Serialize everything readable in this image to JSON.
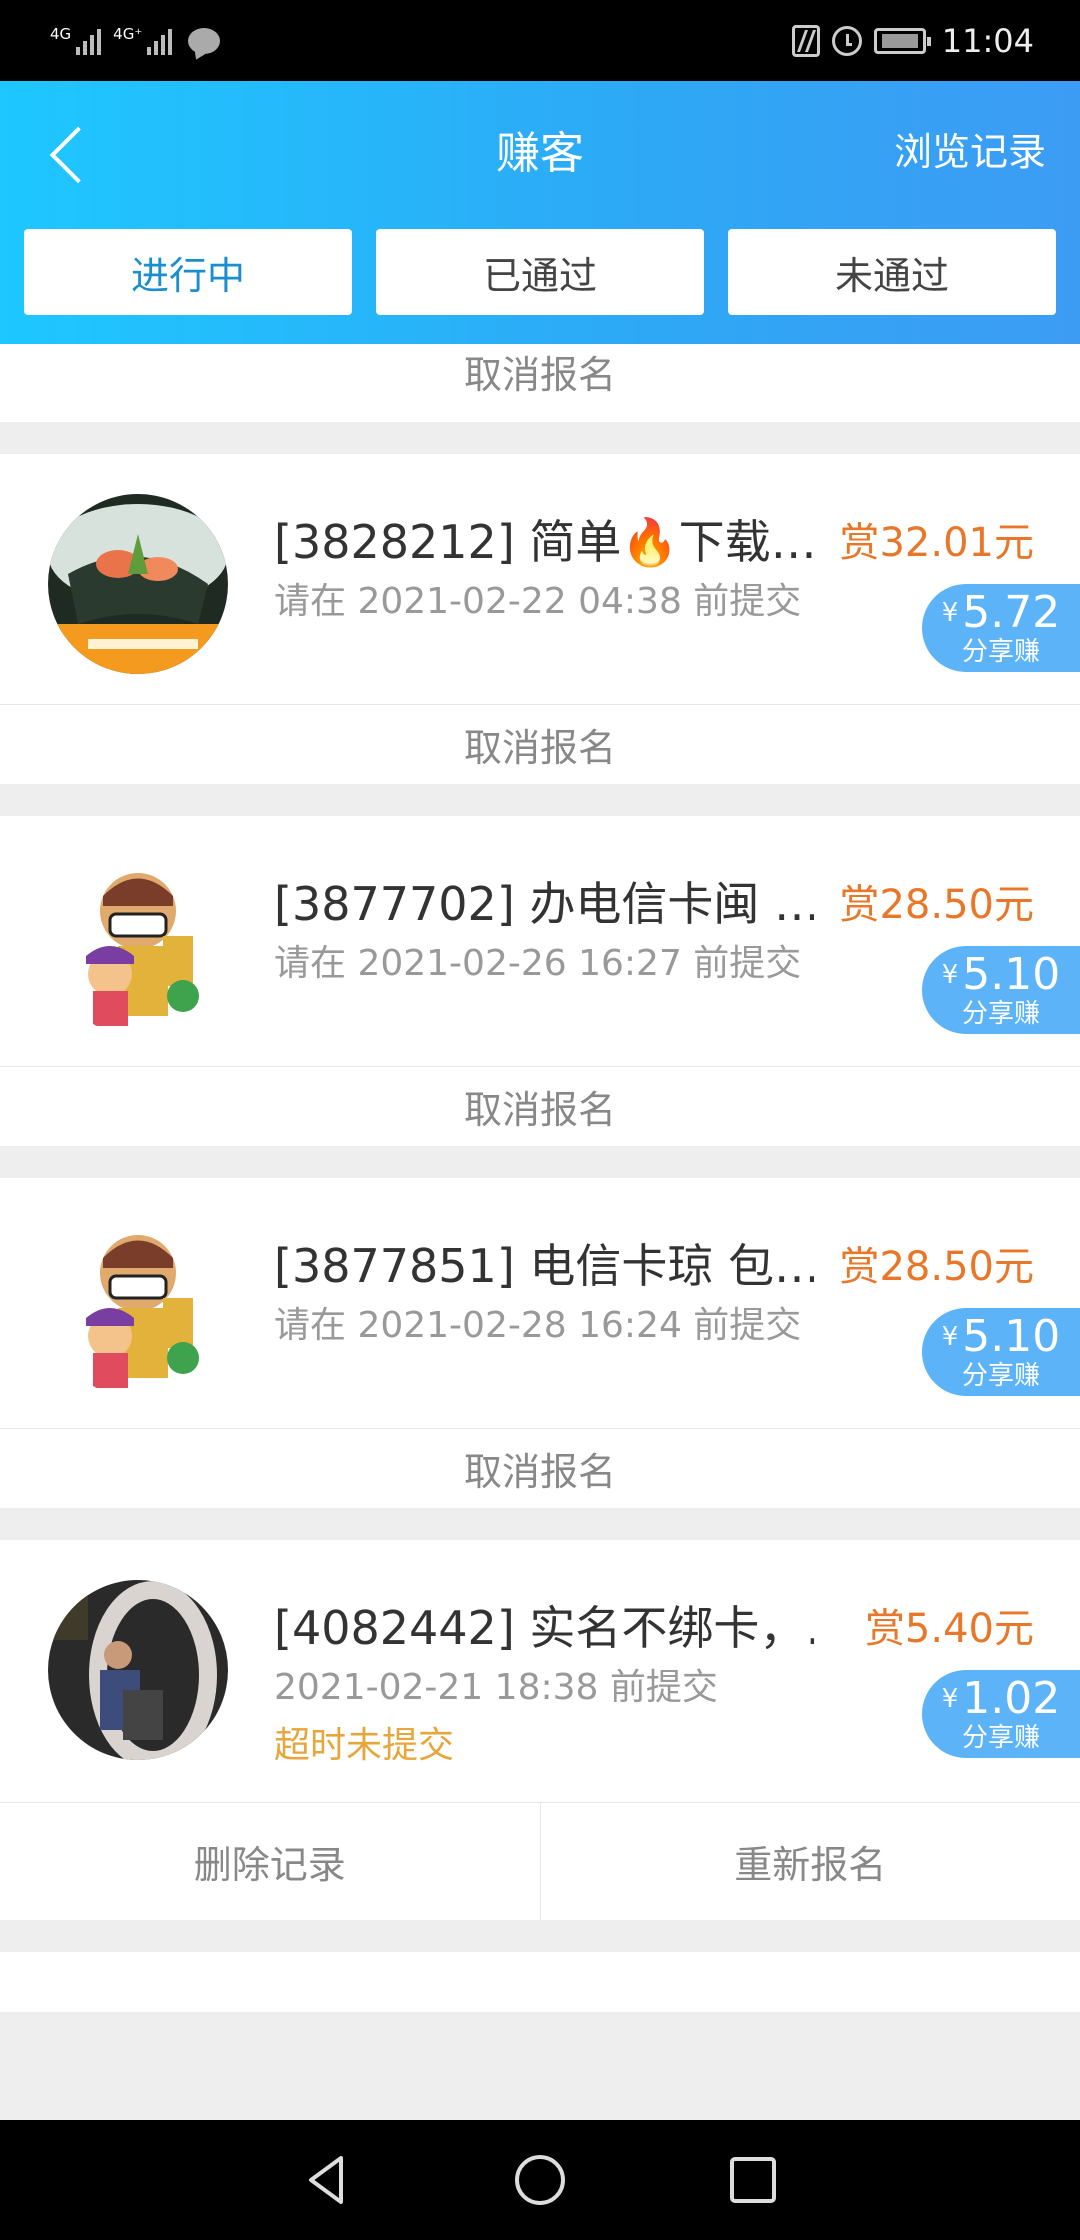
{
  "status_bar": {
    "network1": "4G",
    "network2": "4G⁺",
    "time": "11:04"
  },
  "header": {
    "title": "赚客",
    "history_label": "浏览记录",
    "tabs": [
      "进行中",
      "已通过",
      "未通过"
    ],
    "active_tab": 0
  },
  "partial_action": "取消报名",
  "tasks": [
    {
      "title": "[3828212] 简单🔥下载…",
      "deadline": "请在 2021-02-22 04:38 前提交",
      "reward": "赏32.01元",
      "share_currency": "¥",
      "share_amount": "5.72",
      "share_label": "分享赚",
      "actions": [
        "取消报名"
      ]
    },
    {
      "title": "[3877702] 办电信卡闽 …",
      "deadline": "请在 2021-02-26 16:27 前提交",
      "reward": "赏28.50元",
      "share_currency": "¥",
      "share_amount": "5.10",
      "share_label": "分享赚",
      "actions": [
        "取消报名"
      ]
    },
    {
      "title": "[3877851] 电信卡琼 包…",
      "deadline": "请在 2021-02-28 16:24 前提交",
      "reward": "赏28.50元",
      "share_currency": "¥",
      "share_amount": "5.10",
      "share_label": "分享赚",
      "actions": [
        "取消报名"
      ]
    },
    {
      "title": "[4082442] 实名不绑卡，…",
      "deadline": "2021-02-21 18:38 前提交",
      "status": "超时未提交",
      "reward": "赏5.40元",
      "share_currency": "¥",
      "share_amount": "1.02",
      "share_label": "分享赚",
      "actions": [
        "删除记录",
        "重新报名"
      ]
    }
  ]
}
